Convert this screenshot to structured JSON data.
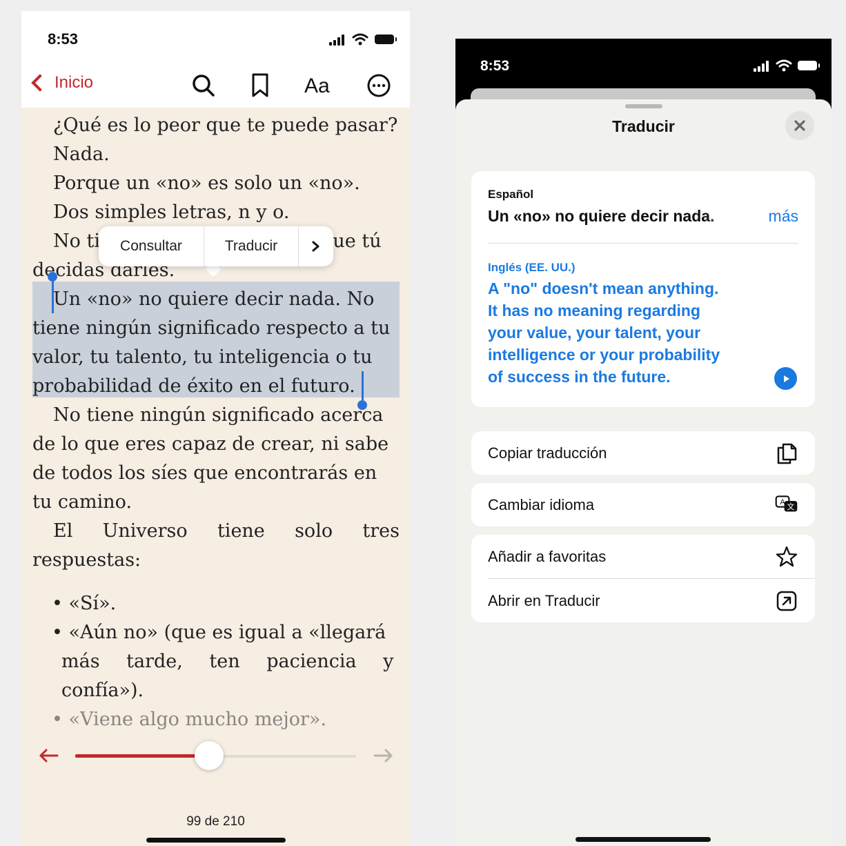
{
  "left_phone": {
    "status": {
      "time": "8:53"
    },
    "nav": {
      "back_label": "Inicio",
      "font_label": "Aa"
    },
    "book_lines": [
      "¿Qué es lo peor que te puede pasar?",
      "Nada.",
      "Porque un «no» es solo un «no».",
      "Dos simples letras, n y o.",
      "No tienen más poder que el que tú",
      "decidas darles."
    ],
    "selected_lines": [
      "Un «no» no quiere decir nada. No",
      "tiene ningún significado respecto a tu",
      "valor, tu talento, tu inteligencia o tu",
      "probabilidad de éxito en el futuro."
    ],
    "after_lines": [
      "No tiene ningún significado acerca",
      "de lo que eres capaz de crear, ni sabe",
      "de todos los síes que encontrarás en",
      "tu camino.",
      "El Universo tiene solo tres",
      "respuestas:"
    ],
    "bullets": [
      "«Sí».",
      "«Aún no» (que es igual a «llegará",
      "más tarde, ten paciencia y",
      "confía»).",
      "«Viene algo mucho mejor»."
    ],
    "popup": {
      "consult": "Consultar",
      "translate": "Traducir"
    },
    "progress": {
      "current_page": 99,
      "total_pages": 210,
      "label": "99 de 210",
      "fraction": 0.47
    },
    "accent_color": "#c0282d",
    "selection_color": "#2a72d6"
  },
  "right_phone": {
    "status": {
      "time": "8:53"
    },
    "sheet": {
      "title": "Traducir",
      "source_language": "Español",
      "source_text": "Un «no» no quiere decir nada.",
      "more_label": "más",
      "target_language": "Inglés (EE. UU.)",
      "translation_lines": [
        "A \"no\" doesn't mean anything.",
        "It has no meaning regarding",
        "your value, your talent, your",
        "intelligence or your probability",
        "of success in the future."
      ]
    },
    "actions": [
      {
        "label": "Copiar traducción",
        "icon": "copy-icon"
      },
      {
        "label": "Cambiar idioma",
        "icon": "translate-language-icon"
      },
      {
        "label": "Añadir a favoritas",
        "icon": "star-icon"
      },
      {
        "label": "Abrir en Traducir",
        "icon": "open-external-icon"
      }
    ],
    "accent_color": "#1a7ae0"
  }
}
